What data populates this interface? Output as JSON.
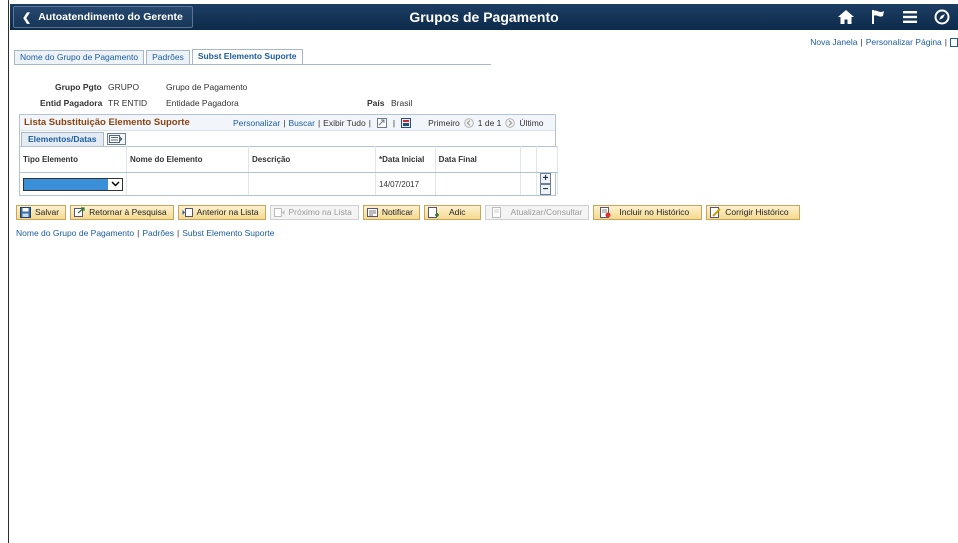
{
  "banner": {
    "back_label": "Autoatendimento do Gerente",
    "title": "Grupos de Pagamento",
    "icons": [
      "home-icon",
      "flag-icon",
      "menu-icon",
      "compass-icon"
    ]
  },
  "toplinks": {
    "new_window": "Nova Janela",
    "personalize_page": "Personalizar Página"
  },
  "tabs": [
    {
      "label": "Nome do Grupo de Pagamento"
    },
    {
      "label": "Padrões"
    },
    {
      "label": "Subst Elemento Suporte"
    }
  ],
  "fields": {
    "grupo_pgto_label": "Grupo Pgto",
    "grupo_pgto_value": "GRUPO",
    "grupo_pgto_desc": "Grupo de Pagamento",
    "entid_label": "Entid Pagadora",
    "entid_value": "TR ENTID",
    "entid_desc": "Entidade Pagadora",
    "pais_label": "País",
    "pais_value": "Brasil"
  },
  "grid": {
    "title": "Lista Substituição Elemento Suporte",
    "personalize": "Personalizar",
    "find": "Buscar",
    "view_all": "Exibir Tudo",
    "first": "Primeiro",
    "range": "1 de 1",
    "last": "Último",
    "tab_label": "Elementos/Datas",
    "columns": {
      "tipo": "Tipo Elemento",
      "nome": "Nome do Elemento",
      "descricao": "Descrição",
      "data_inicial": "*Data Inicial",
      "data_final": "Data Final"
    },
    "rows": [
      {
        "tipo": "",
        "nome": "",
        "descricao": "",
        "data_inicial": "14/07/2017",
        "data_final": ""
      }
    ]
  },
  "toolbar": {
    "save": "Salvar",
    "return": "Retornar à Pesquisa",
    "prev": "Anterior na Lista",
    "next": "Próximo na Lista",
    "notify": "Notificar",
    "add": "Adic",
    "update": "Atualizar/Consultar",
    "include_history": "Incluir no Histórico",
    "correct_history": "Corrigir Histórico"
  },
  "bottomlinks": {
    "nome": "Nome do Grupo de Pagamento",
    "padroes": "Padrões",
    "subst": "Subst Elemento Suporte"
  }
}
